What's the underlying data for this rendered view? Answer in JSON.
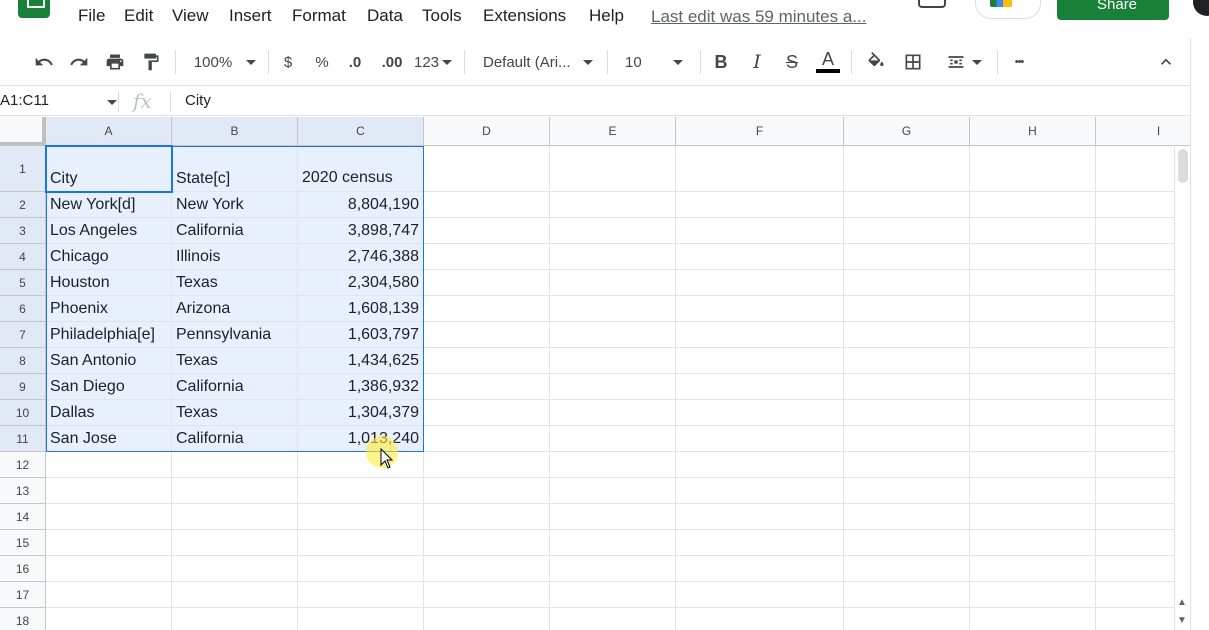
{
  "menubar": {
    "items": [
      "File",
      "Edit",
      "View",
      "Insert",
      "Format",
      "Data",
      "Tools",
      "Extensions",
      "Help"
    ],
    "last_edit": "Last edit was 59 minutes a...",
    "share_label": "Share"
  },
  "toolbar": {
    "zoom": "100%",
    "currency": "$",
    "percent": "%",
    "decrease_decimal": ".0",
    "increase_decimal": ".00",
    "more_formats": "123",
    "font": "Default (Ari...",
    "font_size": "10",
    "bold": "B",
    "italic": "I",
    "strike": "S",
    "text_color": "A",
    "more": "•••",
    "text_color_swatch": "#000000"
  },
  "formula_bar": {
    "name_box": "A1:C11",
    "fx": "fx",
    "value": "City"
  },
  "grid": {
    "columns": [
      "A",
      "B",
      "C",
      "D",
      "E",
      "F",
      "G",
      "H",
      "I"
    ],
    "rows": [
      "1",
      "2",
      "3",
      "4",
      "5",
      "6",
      "7",
      "8",
      "9",
      "10",
      "11",
      "12",
      "13",
      "14",
      "15",
      "16",
      "17",
      "18"
    ],
    "data": [
      [
        "City",
        "State[c]",
        "2020 census"
      ],
      [
        "New York[d]",
        "New York",
        "8,804,190"
      ],
      [
        "Los Angeles",
        "California",
        "3,898,747"
      ],
      [
        "Chicago",
        "Illinois",
        "2,746,388"
      ],
      [
        "Houston",
        "Texas",
        "2,304,580"
      ],
      [
        "Phoenix",
        "Arizona",
        "1,608,139"
      ],
      [
        "Philadelphia[e]",
        "Pennsylvania",
        "1,603,797"
      ],
      [
        "San Antonio",
        "Texas",
        "1,434,625"
      ],
      [
        "San Diego",
        "California",
        "1,386,932"
      ],
      [
        "Dallas",
        "Texas",
        "1,304,379"
      ],
      [
        "San Jose",
        "California",
        "1,013,240"
      ]
    ]
  },
  "colors": {
    "selection": "#e8f0fe",
    "selection_border": "#1a73e8",
    "brand": "#188038"
  }
}
